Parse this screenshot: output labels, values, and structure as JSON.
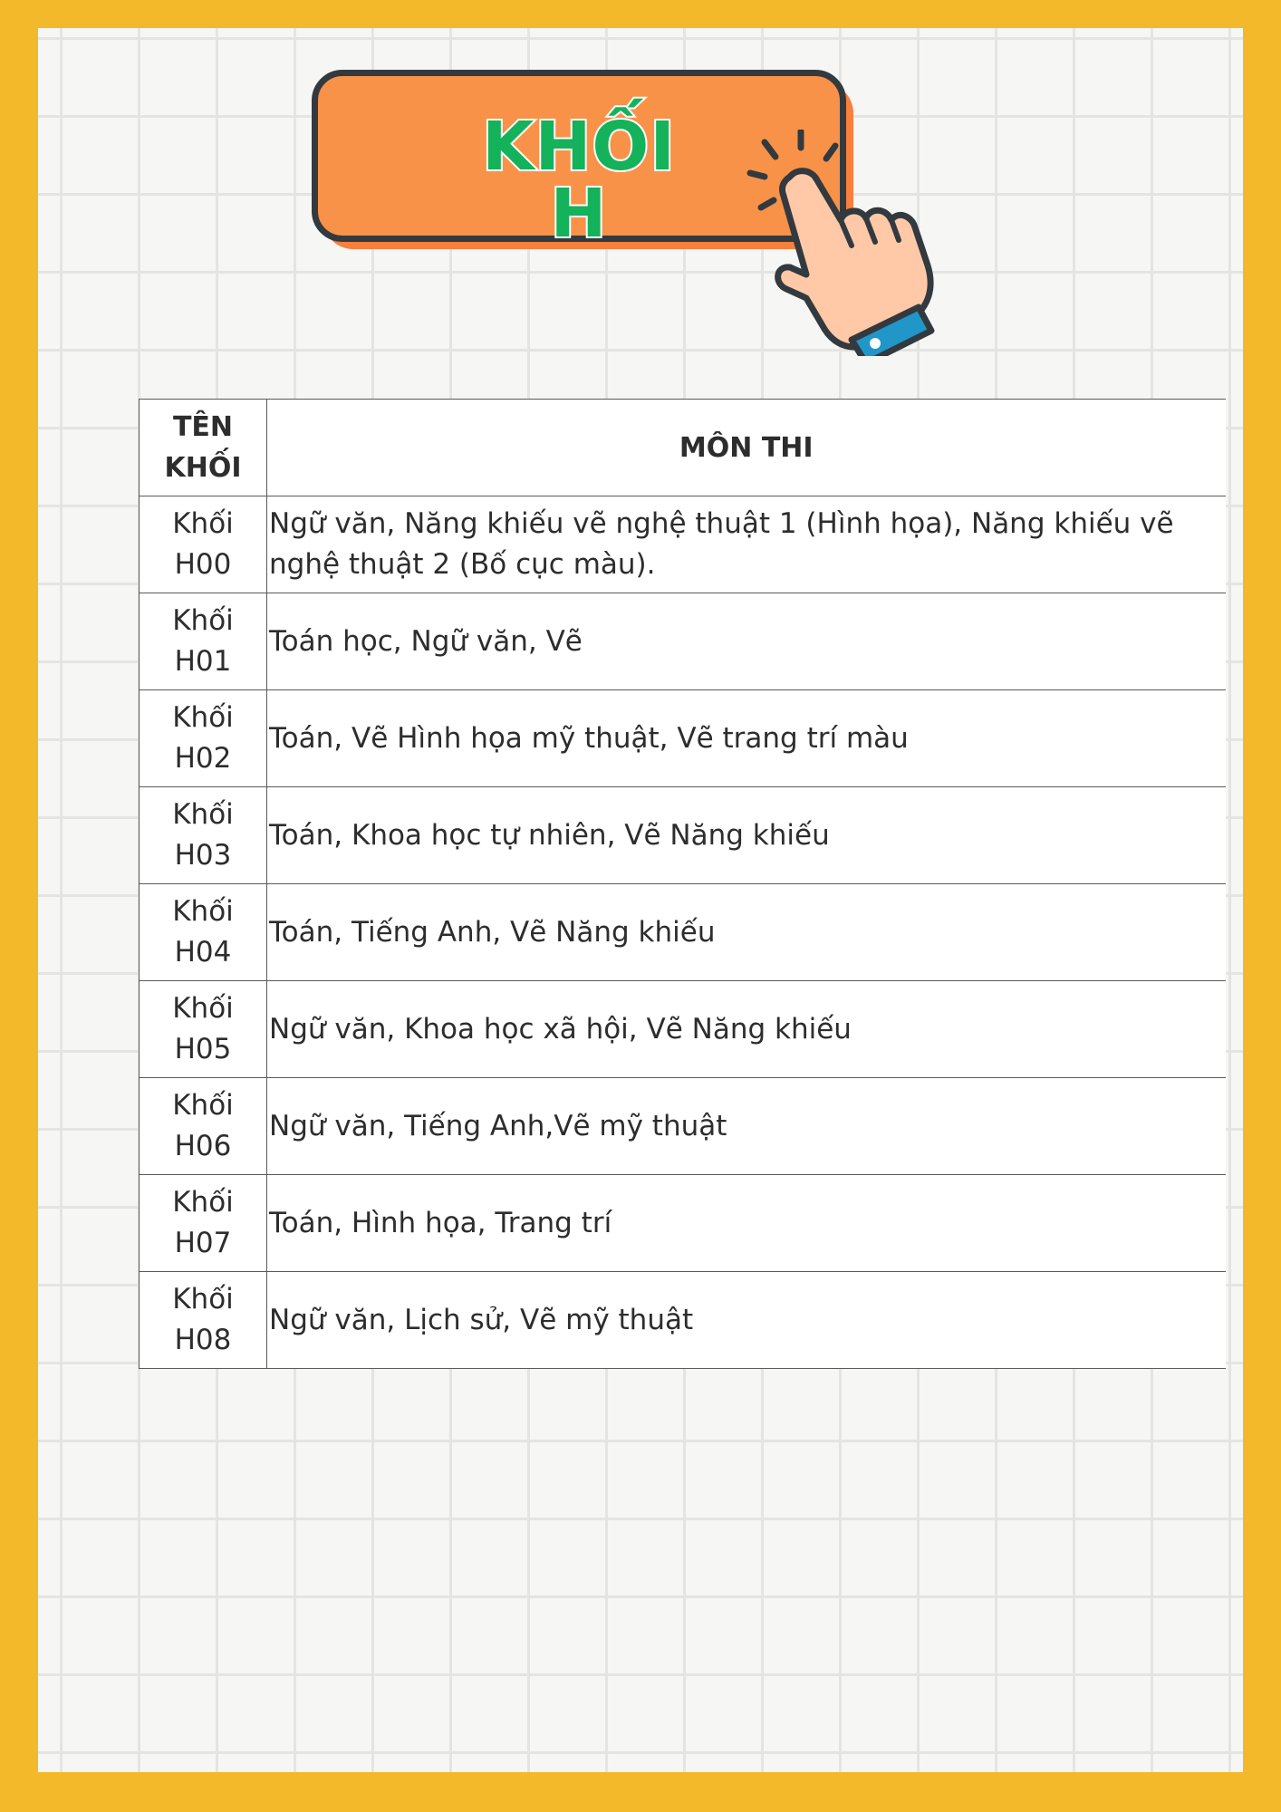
{
  "title": "KHỐI H",
  "table": {
    "headers": [
      "TÊN KHỐI",
      "MÔN THI"
    ],
    "rows": [
      {
        "name": "Khối H00",
        "subjects": "Ngữ văn, Năng khiếu vẽ nghệ thuật 1 (Hình họa), Năng khiếu vẽ nghệ thuật 2 (Bố cục màu)."
      },
      {
        "name": "Khối H01",
        "subjects": "Toán học, Ngữ văn, Vẽ"
      },
      {
        "name": "Khối H02",
        "subjects": "Toán, Vẽ Hình họa mỹ thuật, Vẽ trang trí màu"
      },
      {
        "name": "Khối H03",
        "subjects": "Toán, Khoa học tự nhiên, Vẽ Năng khiếu"
      },
      {
        "name": "Khối H04",
        "subjects": "Toán, Tiếng Anh, Vẽ Năng khiếu"
      },
      {
        "name": "Khối H05",
        "subjects": "Ngữ văn, Khoa học xã hội, Vẽ Năng khiếu"
      },
      {
        "name": "Khối H06",
        "subjects": "Ngữ văn, Tiếng Anh,Vẽ mỹ thuật"
      },
      {
        "name": "Khối H07",
        "subjects": "Toán, Hình họa, Trang trí"
      },
      {
        "name": "Khối H08",
        "subjects": "Ngữ văn, Lịch sử, Vẽ mỹ thuật"
      }
    ]
  },
  "colors": {
    "frame": "#f3b92b",
    "banner": "#f99249",
    "title_text": "#14b25a",
    "hand_cuff": "#2196c8"
  }
}
